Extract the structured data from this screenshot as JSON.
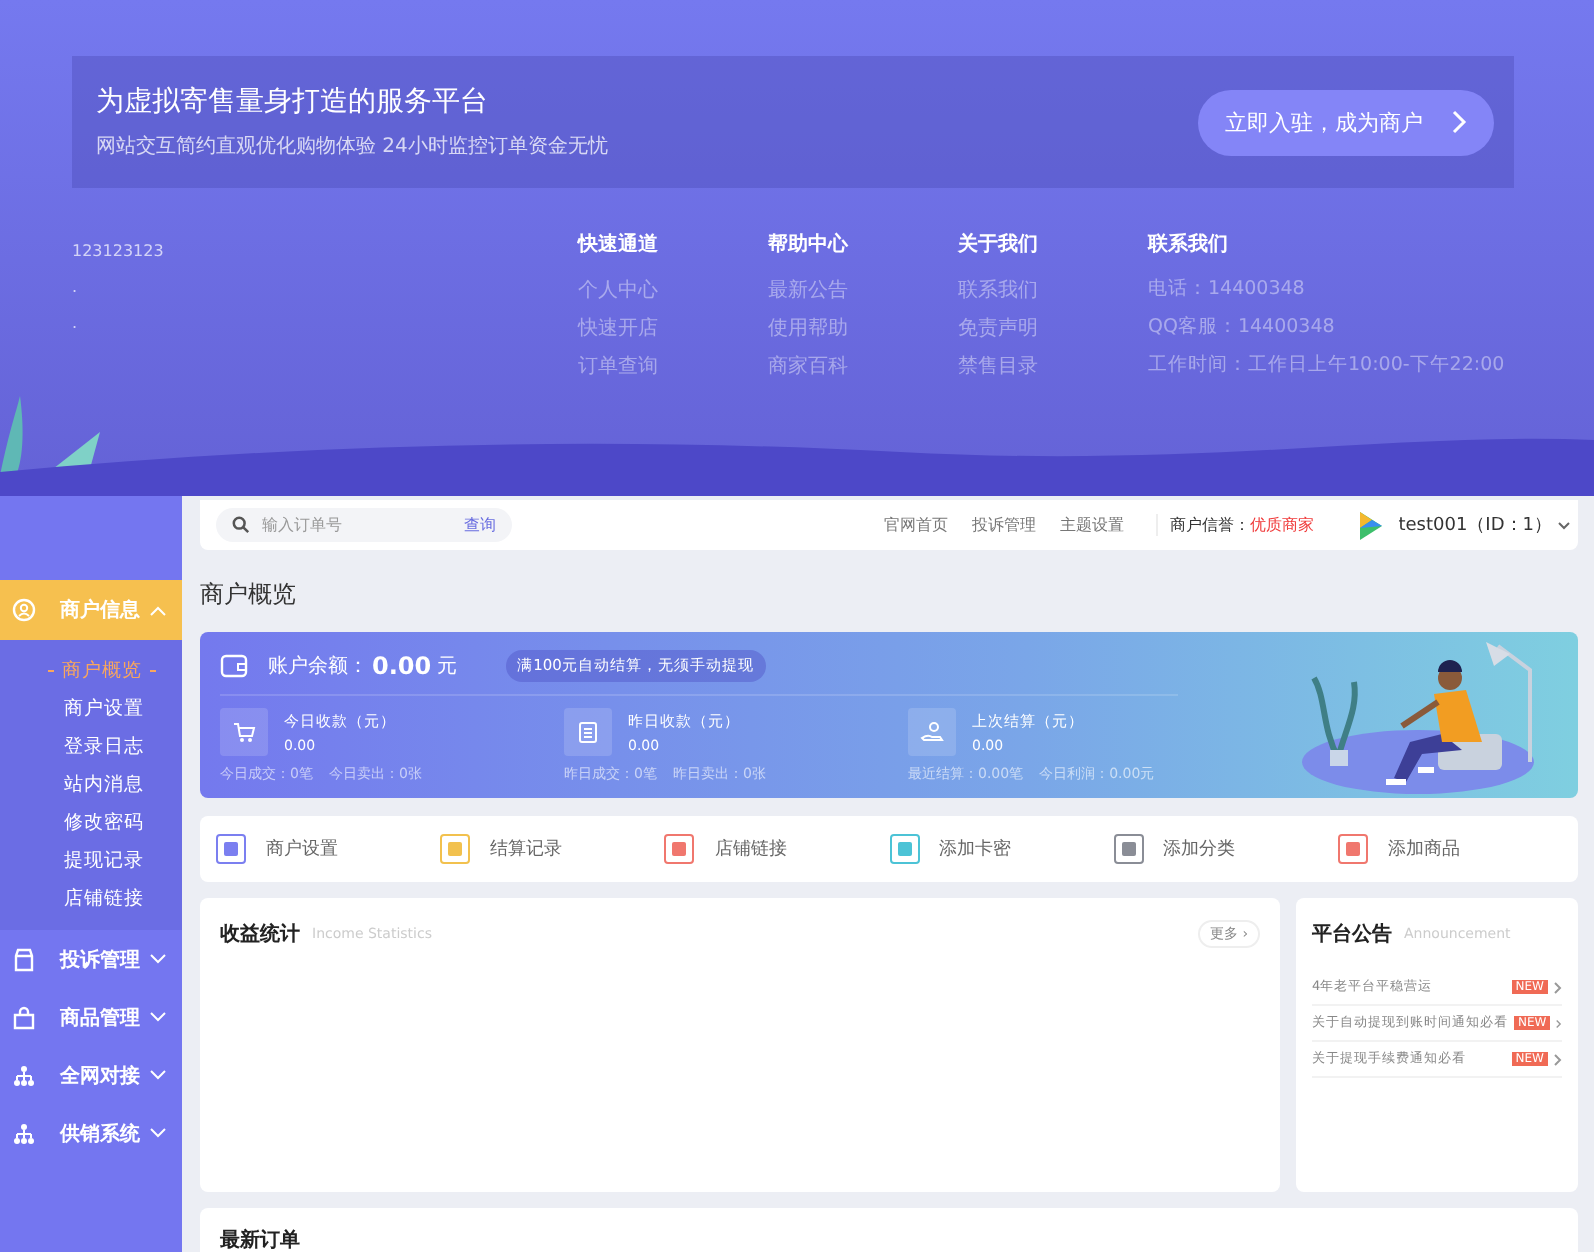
{
  "promo": {
    "title": "为虚拟寄售量身打造的服务平台",
    "subtitle": "网站交互简约直观优化购物体验 24小时监控订单资金无忧",
    "button": "立即入驻，成为商户"
  },
  "footer": {
    "site_lines": [
      "123123123",
      ".",
      "."
    ],
    "columns": [
      {
        "heading": "快速通道",
        "links": [
          "个人中心",
          "快速开店",
          "订单查询"
        ]
      },
      {
        "heading": "帮助中心",
        "links": [
          "最新公告",
          "使用帮助",
          "商家百科"
        ]
      },
      {
        "heading": "关于我们",
        "links": [
          "联系我们",
          "免责声明",
          "禁售目录"
        ]
      },
      {
        "heading": "联系我们",
        "links": [
          "电话：14400348",
          "QQ客服：14400348",
          "工作时间：工作日上午10:00-下午22:00"
        ]
      }
    ]
  },
  "sidebar": {
    "items": [
      {
        "label": "商户信息",
        "expanded": true,
        "selected": true,
        "children": [
          {
            "label": "商户概览",
            "selected": true
          },
          {
            "label": "商户设置",
            "selected": false
          },
          {
            "label": "登录日志",
            "selected": false
          },
          {
            "label": "站内消息",
            "selected": false
          },
          {
            "label": "修改密码",
            "selected": false
          },
          {
            "label": "提现记录",
            "selected": false
          },
          {
            "label": "店铺链接",
            "selected": false
          }
        ]
      },
      {
        "label": "投诉管理",
        "expanded": false,
        "selected": false
      },
      {
        "label": "商品管理",
        "expanded": false,
        "selected": false
      },
      {
        "label": "全网对接",
        "expanded": false,
        "selected": false
      },
      {
        "label": "供销系统",
        "expanded": false,
        "selected": false
      }
    ]
  },
  "topbar": {
    "search": {
      "placeholder": "输入订单号",
      "button": "查询"
    },
    "links": [
      "官网首页",
      "投诉管理",
      "主题设置"
    ],
    "reputation_label": "商户信誉：",
    "reputation_value": "优质商家",
    "user": "test001（ID：1）"
  },
  "page_title": "商户概览",
  "balance": {
    "label": "账户余额：",
    "amount": "0.00",
    "unit": "元",
    "note": "满100元自动结算，无须手动提现",
    "stats": [
      {
        "label": "今日收款（元）",
        "value": "0.00",
        "footer": [
          "今日成交：0笔",
          "今日卖出：0张"
        ]
      },
      {
        "label": "昨日收款（元）",
        "value": "0.00",
        "footer": [
          "昨日成交：0笔",
          "昨日卖出：0张"
        ]
      },
      {
        "label": "上次结算（元）",
        "value": "0.00",
        "footer": [
          "最近结算：0.00笔",
          "今日利润：0.00元"
        ]
      }
    ]
  },
  "quick_links": [
    {
      "label": "商户设置",
      "color": "#7b7ff0"
    },
    {
      "label": "结算记录",
      "color": "#f2c14e"
    },
    {
      "label": "店铺链接",
      "color": "#f0776e"
    },
    {
      "label": "添加卡密",
      "color": "#4cc3d6"
    },
    {
      "label": "添加分类",
      "color": "#8a8d96"
    },
    {
      "label": "添加商品",
      "color": "#f0776e"
    }
  ],
  "income": {
    "title": "收益统计",
    "subtitle": "Income Statistics",
    "more": "更多 ›"
  },
  "announcements": {
    "title": "平台公告",
    "subtitle": "Announcement",
    "items": [
      {
        "text": "4年老平台平稳营运",
        "badge": "NEW"
      },
      {
        "text": "关于自动提现到账时间通知必看",
        "badge": "NEW"
      },
      {
        "text": "关于提现手续费通知必看",
        "badge": "NEW"
      }
    ]
  },
  "orders": {
    "title": "最新订单"
  }
}
